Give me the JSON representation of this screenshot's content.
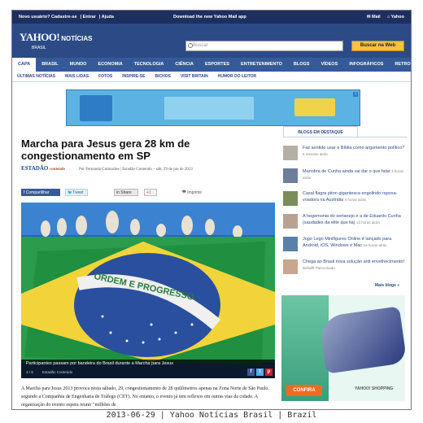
{
  "topbar": {
    "new_user": "Novo usuário? Cadastre-se",
    "login": "Entrar",
    "help": "Ajuda",
    "center": "Download the new Yahoo Mail app",
    "mail": "Mail",
    "yahoo": "Yahoo"
  },
  "header": {
    "logo": "YAHOO!",
    "logo_sub": "NOTÍCIAS",
    "logo_brasil": "BRASIL",
    "search_placeholder": "Buscar",
    "search_button": "Buscar na Web"
  },
  "nav": [
    "CAPA",
    "BRASIL",
    "MUNDO",
    "ECONOMIA",
    "TECNOLOGIA",
    "CIÊNCIA",
    "ESPORTES",
    "ENTRETENIMENTO",
    "BLOGS",
    "VÍDEOS",
    "INFOGRÁFICOS",
    "RETROSPECTIVA"
  ],
  "subnav": [
    "ÚLTIMAS NOTÍCIAS",
    "MAIS LIDAS",
    "FOTOS",
    "INSPIRE-SE",
    "BICHOS",
    "VISIT BRITAIN",
    "HUMOR DO LEITOR"
  ],
  "article": {
    "title": "Marcha para Jesus gera 28 km de congestionamento em SP",
    "source_logo": "ESTADÃO",
    "source_logo_sub": "conteúdo",
    "byline": "Por Fernanda Guimarães | Estadão Conteúdo – sáb, 29 de jun de 2013",
    "share_fb": "Compartilhar",
    "share_tw": "Tweet",
    "share_in": "Share",
    "share_gp": "+1",
    "print": "Imprimir",
    "photo_banner": "ORDEM E PROGRESSO",
    "caption": "Participantes passam por bandeira do Brasil durante a Marcha para Jesus",
    "photo_count": "3 / 8",
    "photo_source": "Estadão Conteúdo",
    "body": "A Marcha para Jesus 2013 provoca nesta sábado, 29, congestionamento de 28 quilômetros apenas na Zona Norte de São Paulo, segundo a Companhia de Engenharia de Tráfego (CET). No entanto, o evento já tem reflexos em outras vias da cidade. A organização do evento espera reunir \"milhões de"
  },
  "blogs": {
    "header": "BLOGS EM DESTAQUE",
    "items": [
      {
        "text": "Faz sentido usar a Bíblia como argumento político?",
        "time": "6 minutos atrás"
      },
      {
        "text": "Manobra de Cunha ainda vai dar o que falar",
        "time": "3 horas atrás"
      },
      {
        "text": "Casal flagra piton gigantesca engolindo raposa-voadora na Austrália",
        "time": "4 horas atrás"
      },
      {
        "text": "A hegemonia do sertanejo e a de Eduardo Cunha (saudades da elite que lia)",
        "time": "13 horas atrás"
      },
      {
        "text": "Jogo Lego Minifigures Online é lançado para Android, iOS, Windows e Mac",
        "time": "16 horas atrás"
      },
      {
        "text": "Chega ao Brasil nova solução anti envelhecimento!",
        "time": "Bellalift Patrocinado"
      }
    ],
    "more": "Mais blogs »"
  },
  "side_ad": {
    "button": "CONFIRA",
    "brand": "YAHOO! SHOPPING"
  },
  "footer": "2013-06-29 | Yahoo Notícias Brasil | Brazil"
}
